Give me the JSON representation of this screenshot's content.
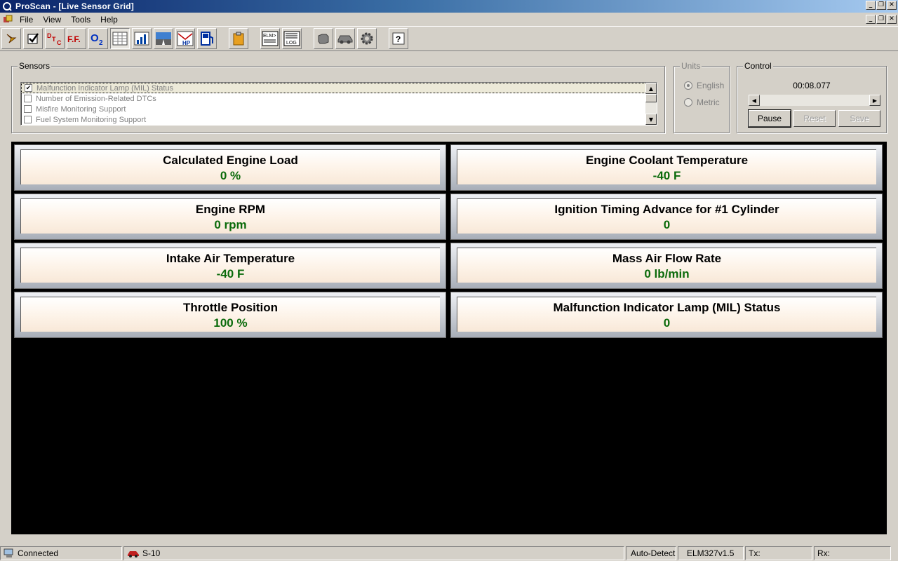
{
  "window": {
    "title": "ProScan - [Live Sensor Grid]"
  },
  "menu": {
    "items": [
      "File",
      "View",
      "Tools",
      "Help"
    ]
  },
  "toolbar": {
    "buttons": [
      {
        "icon": "connect-icon"
      },
      {
        "icon": "checkmark-icon"
      },
      {
        "icon": "dtc-icon",
        "text": "DTC"
      },
      {
        "icon": "freeze-frame-icon",
        "text": "F.F."
      },
      {
        "icon": "o2-sensor-icon",
        "text": "O2"
      },
      {
        "icon": "sensor-grid-icon",
        "selected": true
      },
      {
        "icon": "graph-icon"
      },
      {
        "icon": "dashboard-icon"
      },
      {
        "icon": "horsepower-icon",
        "text": "HP"
      },
      {
        "icon": "fuel-icon"
      },
      {
        "icon": "clipboard-icon"
      },
      {
        "icon": "elm-terminal-icon",
        "text": "ELM>"
      },
      {
        "icon": "log-icon",
        "text": "LOG"
      },
      {
        "icon": "engine-icon"
      },
      {
        "icon": "car-icon"
      },
      {
        "icon": "gear-icon"
      },
      {
        "icon": "help-icon",
        "text": "?"
      }
    ]
  },
  "sensors": {
    "label": "Sensors",
    "items": [
      {
        "label": "Malfunction Indicator Lamp (MIL) Status",
        "checked": true
      },
      {
        "label": "Number of Emission-Related DTCs",
        "checked": false
      },
      {
        "label": "Misfire Monitoring Support",
        "checked": false
      },
      {
        "label": "Fuel System Monitoring Support",
        "checked": false
      }
    ]
  },
  "units": {
    "label": "Units",
    "options": [
      "English",
      "Metric"
    ],
    "selected": "English"
  },
  "control": {
    "label": "Control",
    "timer": "00:08.077",
    "pause_label": "Pause",
    "reset_label": "Reset",
    "save_label": "Save"
  },
  "grid": {
    "tiles": [
      {
        "name": "Calculated Engine Load",
        "value": "0 %"
      },
      {
        "name": "Engine Coolant Temperature",
        "value": "-40 F"
      },
      {
        "name": "Engine RPM",
        "value": "0 rpm"
      },
      {
        "name": "Ignition Timing Advance for #1 Cylinder",
        "value": "0"
      },
      {
        "name": "Intake Air Temperature",
        "value": "-40 F"
      },
      {
        "name": "Mass Air Flow Rate",
        "value": "0 lb/min"
      },
      {
        "name": "Throttle Position",
        "value": "100 %"
      },
      {
        "name": "Malfunction Indicator Lamp (MIL) Status",
        "value": "0"
      }
    ],
    "colors": {
      "value": "#0a6a0a",
      "background": "#000000"
    }
  },
  "statusbar": {
    "connection": "Connected",
    "vehicle": "S-10",
    "protocol": "Auto-Detect",
    "interface": "ELM327v1.5",
    "tx": "Tx:",
    "rx": "Rx:"
  }
}
